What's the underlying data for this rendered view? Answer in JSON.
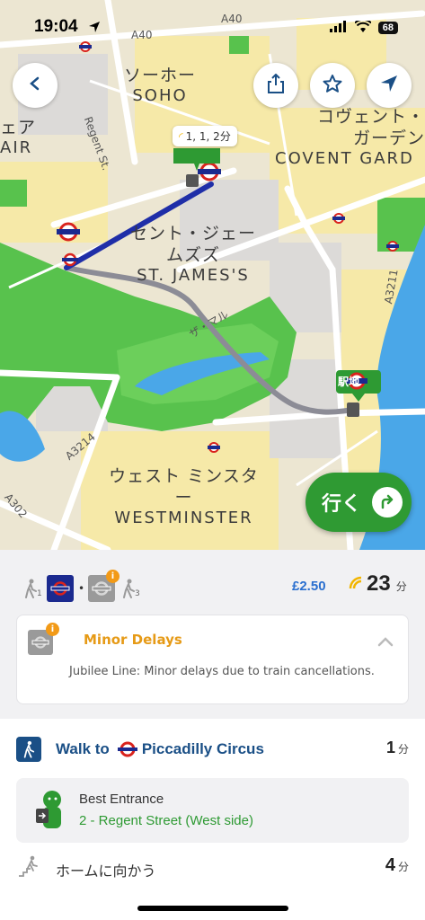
{
  "status_bar": {
    "time": "19:04",
    "battery": "68"
  },
  "map": {
    "areas": [
      {
        "jp": "ソーホー",
        "en": "SOHO"
      },
      {
        "jp": "コヴェント・ガーデン",
        "en": "COVENT GARD"
      },
      {
        "jp": "セント・ジェームズズ",
        "en": "ST. JAMES'S"
      },
      {
        "jp": "ウェスト ミンスター",
        "en": "WESTMINSTER"
      },
      {
        "jp": "ェア",
        "en": "AIR"
      }
    ],
    "roads": [
      "A40",
      "A40",
      "Regent St.",
      "ザ・マル",
      "A3214",
      "A3211",
      "A302"
    ],
    "route_callout": "1, 1, 2分",
    "station_badge": "駅地"
  },
  "map_buttons": {
    "back": "back-chevron",
    "share": "share-icon",
    "favorite": "star-icon",
    "locate": "location-arrow-icon"
  },
  "go_button": {
    "label": "行く"
  },
  "summary": {
    "steps": [
      "1",
      "3"
    ],
    "price": "£2.50",
    "duration": "23",
    "duration_unit": "分"
  },
  "alert": {
    "title": "Minor Delays",
    "text": "Jubilee Line: Minor delays due to train cancellations."
  },
  "walk": {
    "prefix": "Walk to",
    "station": "Piccadilly Circus",
    "minutes": "1",
    "unit": "分",
    "entrance_label": "Best Entrance",
    "entrance_value": "2 - Regent Street (West side)"
  },
  "platform": {
    "label": "ホームに向かう",
    "minutes": "4",
    "unit": "分"
  },
  "colors": {
    "route_tube": "#1f2ea8",
    "route_walk": "#8c8c96",
    "go_green": "#2f9a33",
    "park_green": "#58c24d",
    "river": "#4aa7e8",
    "delay_orange": "#e69a16",
    "walk_blue": "#1a4f86",
    "price_blue": "#2a6fcf"
  }
}
